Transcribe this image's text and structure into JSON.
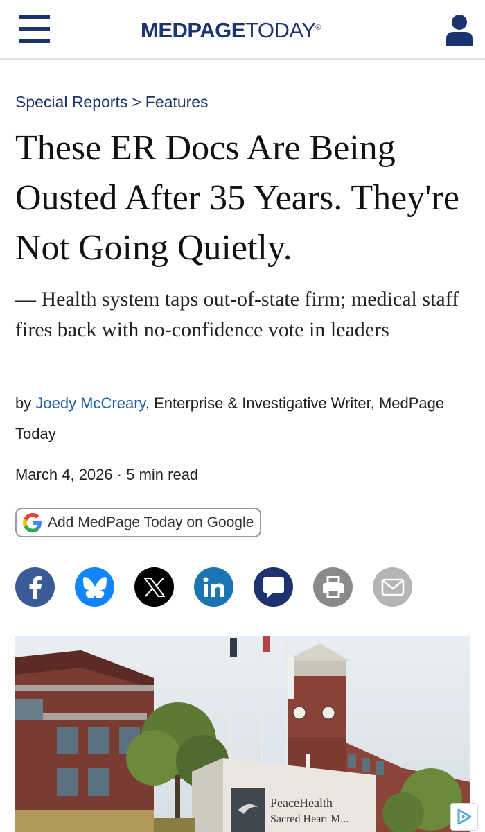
{
  "header": {
    "logo_bold": "MEDPAGE",
    "logo_light": "TODAY",
    "logo_mark": "®",
    "menu_icon": "hamburger-menu-icon",
    "account_icon": "user-account-icon",
    "brand_color": "#1d3270"
  },
  "breadcrumb": {
    "section": "Special Reports",
    "separator": ">",
    "subsection": "Features"
  },
  "article": {
    "headline": "These ER Docs Are Being Ousted After 35 Years. They're Not Going Quietly.",
    "dek": "— Health system taps out-of-state firm; medical staff fires back with no-confidence vote in leaders",
    "byline_prefix": "by ",
    "author": "Joedy McCreary",
    "author_role": ", Enterprise & Investigative Writer, MedPage Today",
    "date": "March 4, 2026",
    "dot": "·",
    "read_time": "5 min read"
  },
  "google_follow": {
    "label": "Add MedPage Today on Google",
    "icon": "google-g-icon"
  },
  "share": [
    {
      "name": "facebook",
      "icon": "facebook-icon",
      "color": "#3b5a98"
    },
    {
      "name": "bluesky",
      "icon": "bluesky-butterfly-icon",
      "color": "#1185fe"
    },
    {
      "name": "x",
      "icon": "x-logo-icon",
      "color": "#000000"
    },
    {
      "name": "linkedin",
      "icon": "linkedin-icon",
      "color": "#1b75b3"
    },
    {
      "name": "comments",
      "icon": "comment-bubble-icon",
      "color": "#1d3270"
    },
    {
      "name": "print",
      "icon": "printer-icon",
      "color": "#8a8a8a"
    },
    {
      "name": "email",
      "icon": "envelope-icon",
      "color": "#b5b5b5"
    }
  ],
  "photo": {
    "sign_text_1": "PeaceHealth",
    "sign_text_2": "Sacred Heart M..."
  },
  "ad": {
    "icon": "adchoices-icon"
  }
}
